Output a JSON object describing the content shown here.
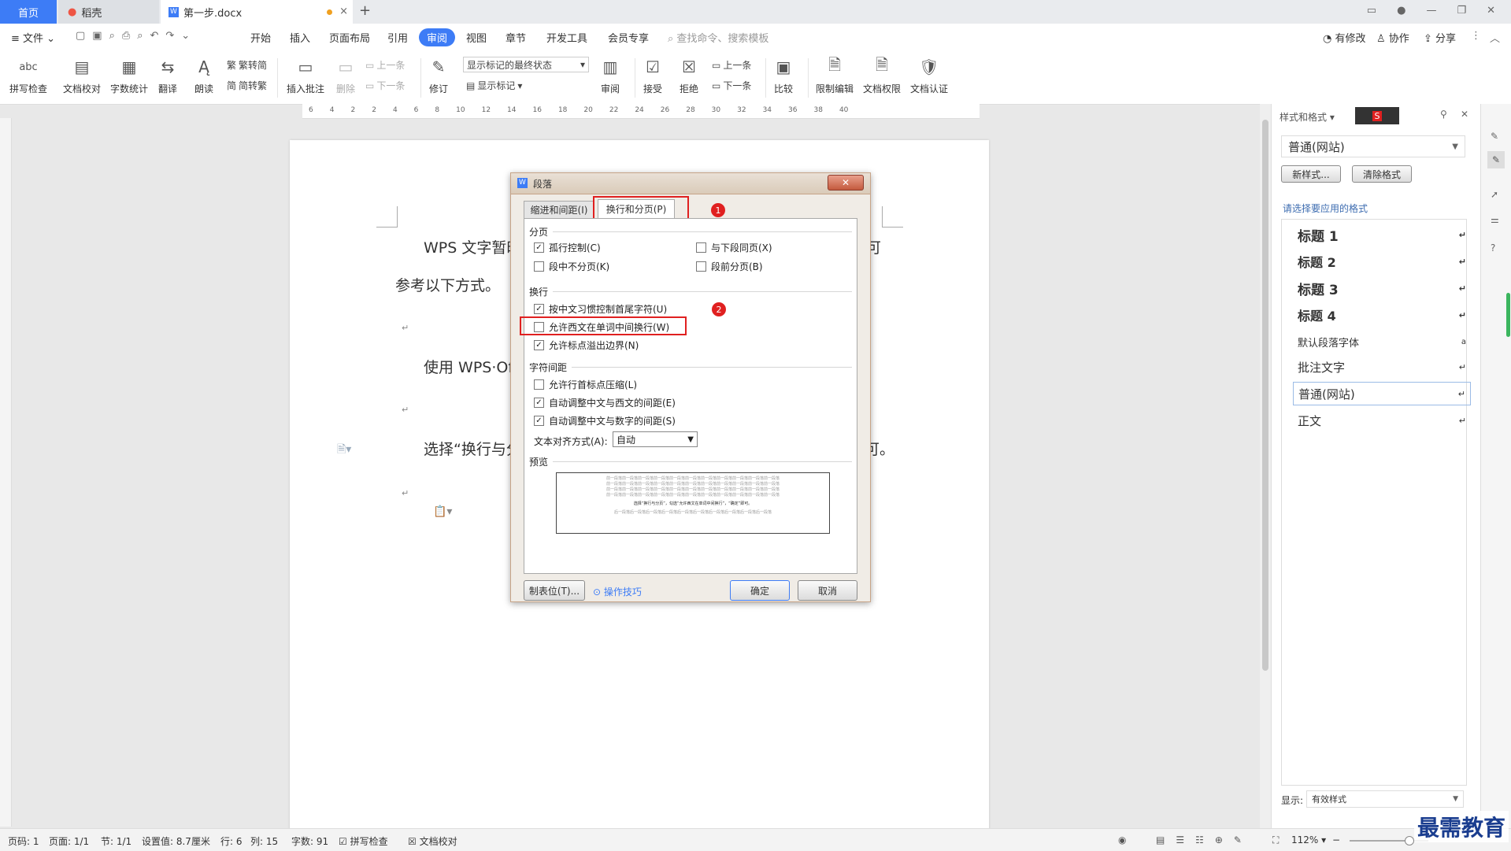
{
  "tabs": {
    "home": "首页",
    "daoke": "稻壳",
    "doc": "第一步.docx"
  },
  "menu": {
    "file": "文件",
    "items": [
      "开始",
      "插入",
      "页面布局",
      "引用",
      "审阅",
      "视图",
      "章节",
      "开发工具",
      "会员专享"
    ],
    "search_placeholder": "查找命令、搜索模板",
    "right": [
      "有修改",
      "协作",
      "分享"
    ]
  },
  "ribbon": {
    "spell": "拼写检查",
    "proof": "文档校对",
    "count": "字数统计",
    "translate": "翻译",
    "read": "朗读",
    "trad": "繁转简",
    "simp": "简转繁",
    "insert_comment": "插入批注",
    "delete": "删除",
    "prev": "上一条",
    "next": "下一条",
    "revise": "修订",
    "markup_state": "显示标记的最终状态",
    "show_markup": "显示标记",
    "review": "审阅",
    "accept": "接受",
    "reject": "拒绝",
    "prev2": "上一条",
    "next2": "下一条",
    "compare": "比较",
    "restrict": "限制编辑",
    "perm": "文档权限",
    "cert": "文档认证"
  },
  "ruler_ticks": [
    "6",
    "4",
    "2",
    "2",
    "4",
    "6",
    "8",
    "10",
    "12",
    "14",
    "16",
    "18",
    "20",
    "22",
    "24",
    "26",
    "28",
    "30",
    "32",
    "34",
    "36",
    "38",
    "40"
  ],
  "document": {
    "line1": "WPS 文字暂时",
    "line1_tail": "可",
    "line2": "参考以下方式。",
    "line3": "使用 WPS·Off",
    "line4": "选择“换行与分",
    "line4_tail": "可。"
  },
  "dialog": {
    "title": "段落",
    "tab_indent": "缩进和间距(I)",
    "tab_break": "换行和分页(P)",
    "sec_pagination": "分页",
    "widow": "孤行控制(C)",
    "keep_next": "与下段同页(X)",
    "keep_lines": "段中不分页(K)",
    "page_break_before": "段前分页(B)",
    "sec_linebreak": "换行",
    "cjk_rules": "按中文习惯控制首尾字符(U)",
    "allow_word_break": "允许西文在单词中间换行(W)",
    "punct_overflow": "允许标点溢出边界(N)",
    "sec_spacing": "字符间距",
    "compress_punct": "允许行首标点压缩(L)",
    "auto_cjk_latin": "自动调整中文与西文的间距(E)",
    "auto_cjk_num": "自动调整中文与数字的间距(S)",
    "align_label": "文本对齐方式(A):",
    "align_value": "自动",
    "sec_preview": "预览",
    "preview_line": "前一段落前一段落前一段落前一段落前一段落前一段落前一段落前一段落前一段落前一段落前一段落",
    "preview_center": "选择“换行与分页”，勾选“允许西文在单词中间换行”，“确定”即可。",
    "preview_after": "后一段落后一段落后一段落后一段落后一段落后一段落后一段落后一段落后一段落后一段落",
    "tabs_btn": "制表位(T)...",
    "tips": "操作技巧",
    "ok": "确定",
    "cancel": "取消",
    "badge1": "1",
    "badge2": "2"
  },
  "sidebar": {
    "title": "样式和格式",
    "current_style": "普通(网站)",
    "new_style": "新样式...",
    "clear_format": "清除格式",
    "apply_label": "请选择要应用的格式",
    "styles": [
      "标题 1",
      "标题 2",
      "标题 3",
      "标题 4",
      "默认段落字体",
      "批注文字",
      "普通(网站)",
      "正文"
    ],
    "show_label": "显示:",
    "show_value": "有效样式"
  },
  "status": {
    "page": "页码: 1",
    "pages": "页面: 1/1",
    "section": "节: 1/1",
    "setting": "设置值: 8.7厘米",
    "row": "行: 6",
    "col": "列: 15",
    "words": "字数: 91",
    "spell": "拼写检查",
    "proof": "文档校对",
    "zoom": "112%"
  },
  "watermark": "最需教育"
}
